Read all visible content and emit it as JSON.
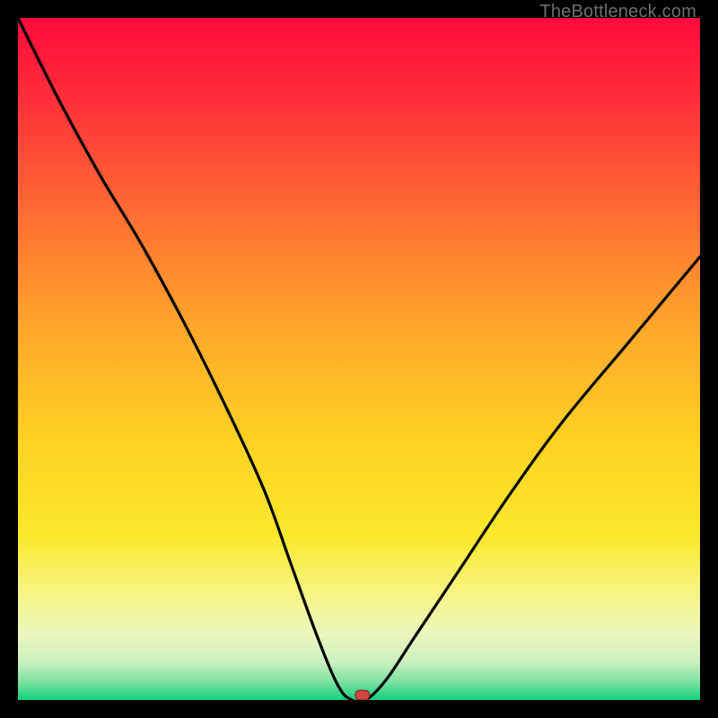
{
  "watermark": "TheBottleneck.com",
  "chart_data": {
    "type": "line",
    "title": "",
    "xlabel": "",
    "ylabel": "",
    "xlim": [
      0,
      100
    ],
    "ylim": [
      0,
      100
    ],
    "grid": false,
    "legend": false,
    "series": [
      {
        "name": "bottleneck-curve",
        "x": [
          0,
          6,
          12,
          18,
          24,
          30,
          36,
          40,
          44,
          47,
          49,
          51,
          54,
          58,
          64,
          72,
          80,
          90,
          100
        ],
        "y": [
          100,
          88,
          77,
          67,
          56,
          44,
          31,
          20,
          9,
          2,
          0,
          0,
          3,
          9,
          18,
          30,
          41,
          53,
          65
        ]
      }
    ],
    "marker": {
      "x": 50.5,
      "y": 0.7,
      "color": "#d2463f"
    },
    "background_gradient": {
      "stops": [
        {
          "offset": 0.0,
          "color": "#ff0a3c"
        },
        {
          "offset": 0.12,
          "color": "#ff2f3a"
        },
        {
          "offset": 0.28,
          "color": "#ff6a33"
        },
        {
          "offset": 0.45,
          "color": "#ffa62b"
        },
        {
          "offset": 0.62,
          "color": "#ffd223"
        },
        {
          "offset": 0.76,
          "color": "#fbe92c"
        },
        {
          "offset": 0.85,
          "color": "#f6f58a"
        },
        {
          "offset": 0.905,
          "color": "#ecf6c0"
        },
        {
          "offset": 0.945,
          "color": "#c9f0bf"
        },
        {
          "offset": 0.975,
          "color": "#77e19f"
        },
        {
          "offset": 1.0,
          "color": "#11d07e"
        }
      ]
    }
  }
}
